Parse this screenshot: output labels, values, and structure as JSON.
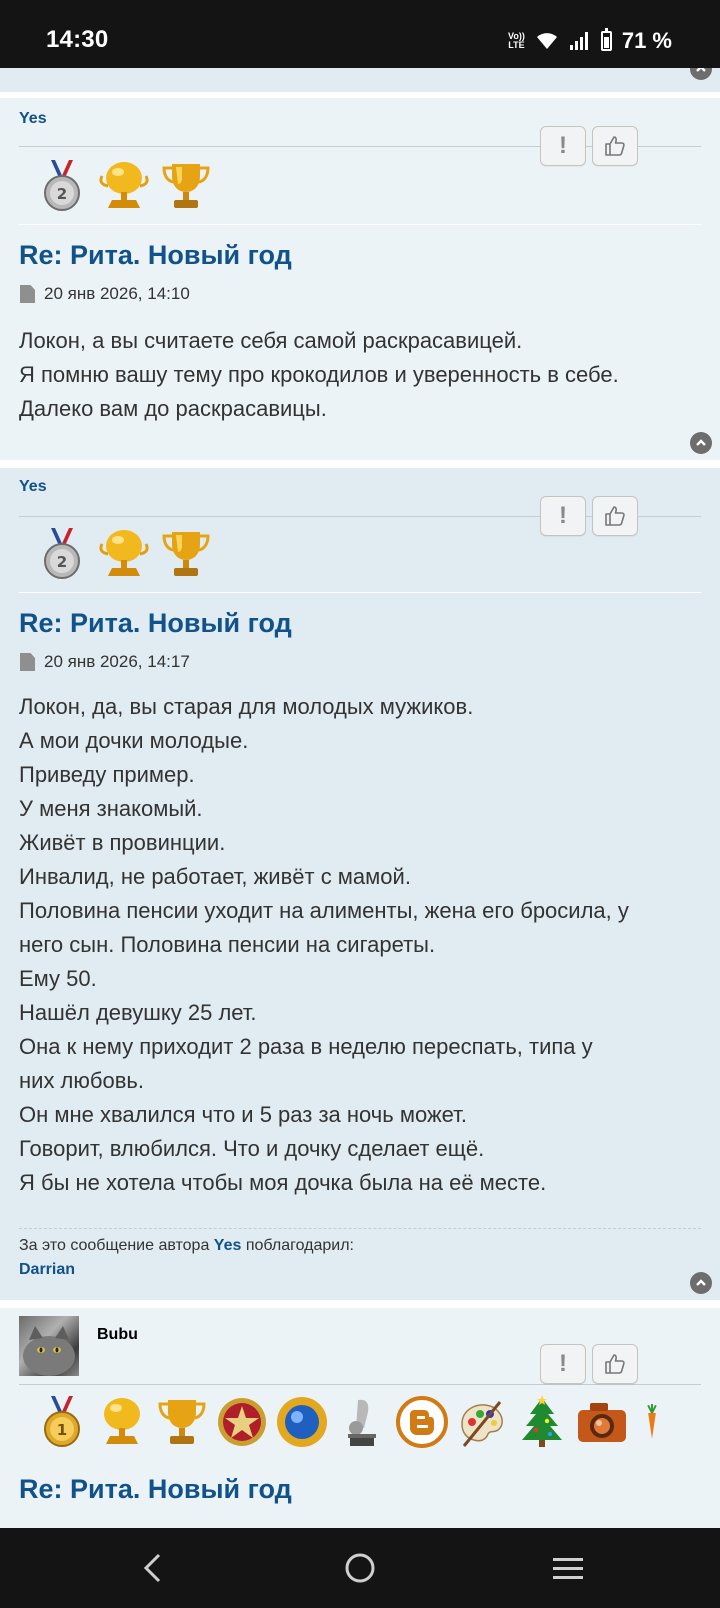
{
  "status": {
    "time": "14:30",
    "volte_top": "Vo))",
    "volte_bottom": "LTE",
    "battery": "71 %"
  },
  "posts": [
    {
      "author": "Yes",
      "title": "Re: Рита. Новый год",
      "date": "20 янв 2026, 14:10",
      "lines": [
        "Локон, а вы считаете себя самой раскрасавицей.",
        "Я помню вашу тему про крокодилов и уверенность в себе.",
        "Далеко вам до раскрасавицы."
      ],
      "medals": [
        "silver-medal-2-icon",
        "gold-cup-icon",
        "gold-trophy-icon"
      ]
    },
    {
      "author": "Yes",
      "title": "Re: Рита. Новый год",
      "date": "20 янв 2026, 14:17",
      "lines": [
        "Локон, да, вы старая для молодых мужиков.",
        "А мои дочки молодые.",
        "Приведу пример.",
        "У меня знакомый.",
        "Живёт в провинции.",
        "Инвалид, не работает, живёт с мамой.",
        "Половина пенсии уходит на алименты, жена его бросила, у",
        "него сын. Половина пенсии на сигареты.",
        "Ему 50.",
        "Нашёл девушку 25 лет.",
        "Она к нему приходит 2 раза в неделю переспать, типа у",
        "них любовь.",
        "Он мне хвалился что и 5 раз за ночь может.",
        "Говорит, влюбился. Что и дочку сделает ещё.",
        "Я бы не хотела чтобы моя дочка была на её месте."
      ],
      "thanks_prefix": "За это сообщение автора",
      "thanks_author": "Yes",
      "thanks_suffix": "поблагодарил:",
      "thanks_user": "Darrian",
      "medals": [
        "silver-medal-2-icon",
        "gold-cup-icon",
        "gold-trophy-icon"
      ]
    },
    {
      "author": "Bubu",
      "title": "Re: Рита. Новый год",
      "medals": [
        "gold-medal-1-icon",
        "gold-cup-icon",
        "gold-trophy-icon",
        "red-star-badge-icon",
        "blue-sun-badge-icon",
        "silver-music-award-icon",
        "blogger-icon",
        "palette-icon",
        "christmas-tree-icon",
        "camera-icon",
        "carrot-icon"
      ]
    }
  ],
  "buttons": {
    "report": "!"
  },
  "colors": {
    "link": "#105289",
    "post_bg_light": "#ecf3f7",
    "post_bg_dark": "#e1ebf2",
    "bar": "#141414"
  }
}
